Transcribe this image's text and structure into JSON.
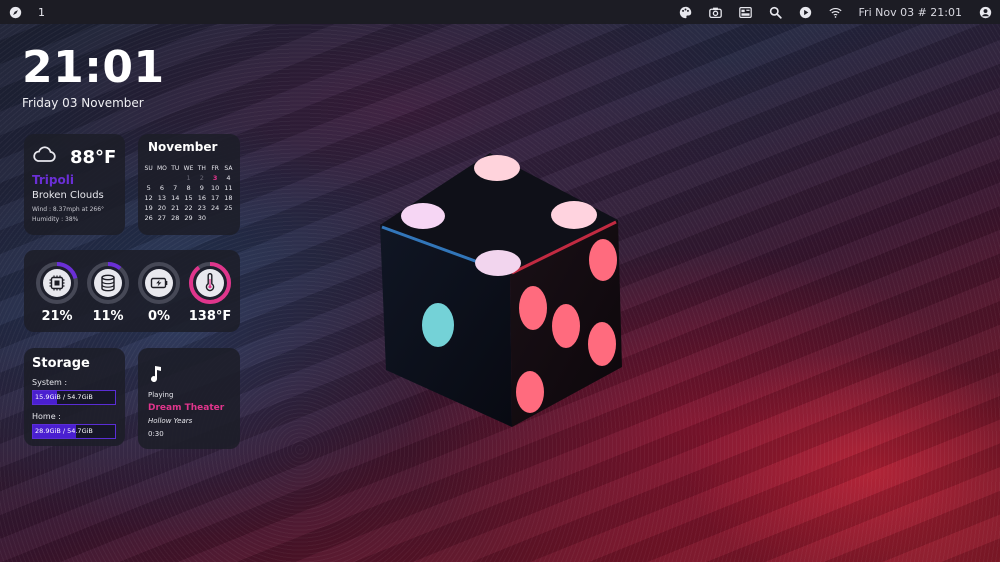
{
  "topbar": {
    "workspace": "1",
    "datetime": "Fri Nov 03 # 21:01",
    "icons": [
      "compass-icon",
      "palette-icon",
      "camera-icon",
      "dashboard-icon",
      "search-icon",
      "play-icon",
      "wifi-icon",
      "user-icon"
    ]
  },
  "clock": {
    "time": "21:01",
    "date": "Friday 03 November"
  },
  "weather": {
    "temp": "88°F",
    "city": "Tripoli",
    "condition": "Broken Clouds",
    "wind": "Wind : 8.37mph at 266°",
    "humidity": "Humidity : 38%",
    "icon": "cloud-icon"
  },
  "calendar": {
    "month": "November",
    "weekdays": [
      "SU",
      "MO",
      "TU",
      "WE",
      "TH",
      "FR",
      "SA"
    ],
    "weeks": [
      [
        "",
        "",
        "",
        "1",
        "2",
        "3",
        "4"
      ],
      [
        "5",
        "6",
        "7",
        "8",
        "9",
        "10",
        "11"
      ],
      [
        "12",
        "13",
        "14",
        "15",
        "16",
        "17",
        "18"
      ],
      [
        "19",
        "20",
        "21",
        "22",
        "23",
        "24",
        "25"
      ],
      [
        "26",
        "27",
        "28",
        "29",
        "30",
        "",
        ""
      ]
    ],
    "today": "3",
    "past": [
      "1",
      "2"
    ]
  },
  "stats": [
    {
      "icon": "cpu-icon",
      "value": "21%",
      "fraction": 0.21,
      "color": "#6a2fd6"
    },
    {
      "icon": "database-icon",
      "value": "11%",
      "fraction": 0.11,
      "color": "#6a2fd6"
    },
    {
      "icon": "battery-icon",
      "value": "0%",
      "fraction": 0.0,
      "color": "#6a2fd6"
    },
    {
      "icon": "thermometer-icon",
      "value": "138°F",
      "fraction": 0.9,
      "color": "#e0358c"
    }
  ],
  "storage": {
    "title": "Storage",
    "system_label": "System :",
    "system_value": "15.9GiB / 54.7GiB",
    "system_fraction": 0.29,
    "home_label": "Home :",
    "home_value": "28.9GiB / 54.7GiB",
    "home_fraction": 0.53
  },
  "music": {
    "status": "Playing",
    "artist": "Dream Theater",
    "song": "Hollow Years",
    "time": "0:30",
    "icon": "music-note-icon"
  },
  "colors": {
    "accent_purple": "#6a2fd6",
    "accent_pink": "#e0358c",
    "card_bg": "#1c1e28",
    "topbar_bg": "#1c1c24"
  }
}
